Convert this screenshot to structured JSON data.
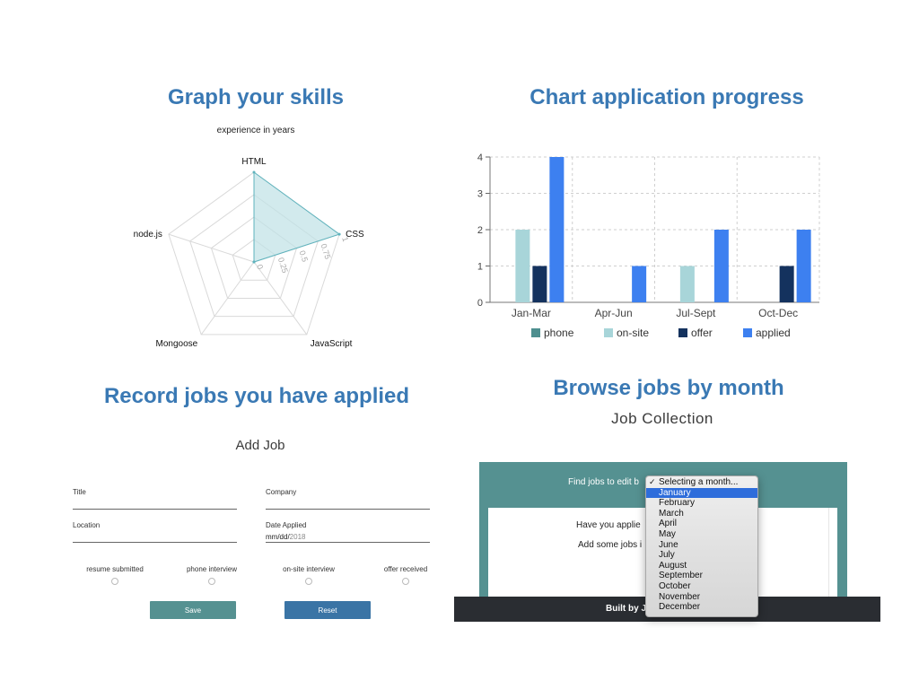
{
  "sections": {
    "skills_title": "Graph your skills",
    "progress_title": "Chart application progress",
    "record_title": "Record jobs you have applied",
    "browse_title": "Browse jobs by month"
  },
  "skills_chart": {
    "subtitle": "experience in years",
    "axes": [
      "HTML",
      "CSS",
      "JavaScript",
      "Mongoose",
      "node.js"
    ],
    "values": [
      1,
      1,
      0,
      0,
      0
    ],
    "ticks": [
      "0",
      "0.25",
      "0.5",
      "0.75",
      "1"
    ],
    "max": 1,
    "fill_color": "#bfe1e6",
    "line_color": "#5fb3bd",
    "grid_color": "#d9d9d9"
  },
  "chart_data": {
    "type": "bar",
    "categories": [
      "Jan-Mar",
      "Apr-Jun",
      "Jul-Sept",
      "Oct-Dec"
    ],
    "series": [
      {
        "name": "phone",
        "color": "#4e8f8f",
        "values": [
          0,
          0,
          0,
          0
        ]
      },
      {
        "name": "on-site",
        "color": "#a8d5d9",
        "values": [
          2,
          0,
          1,
          0
        ]
      },
      {
        "name": "offer",
        "color": "#14325e",
        "values": [
          1,
          0,
          0,
          1
        ]
      },
      {
        "name": "applied",
        "color": "#3d80f0",
        "values": [
          4,
          1,
          2,
          2
        ]
      }
    ],
    "yticks": [
      "0",
      "1",
      "2",
      "3",
      "4"
    ],
    "ylim": [
      0,
      4
    ],
    "grid": true,
    "legend": "bottom"
  },
  "add_job": {
    "title": "Add Job",
    "fields": {
      "title": {
        "label": "Title",
        "value": ""
      },
      "company": {
        "label": "Company",
        "value": ""
      },
      "location": {
        "label": "Location",
        "value": ""
      },
      "date_applied": {
        "label": "Date Applied",
        "placeholder": "mm/dd/",
        "value": "2018"
      }
    },
    "status_options": [
      "resume submitted",
      "phone interview",
      "on-site interview",
      "offer received"
    ],
    "save_label": "Save",
    "reset_label": "Reset",
    "save_color": "#559191",
    "reset_color": "#3a74a5"
  },
  "job_collection": {
    "title": "Job Collection",
    "find_label": "Find jobs to edit b",
    "empty_line1": "Have you applie",
    "empty_line2": "Add some jobs i",
    "footer": "Built by J",
    "panel_color": "#559191"
  },
  "month_dropdown": {
    "placeholder": "Selecting a month...",
    "selected": "January",
    "options": [
      "January",
      "February",
      "March",
      "April",
      "May",
      "June",
      "July",
      "August",
      "September",
      "October",
      "November",
      "December"
    ]
  }
}
